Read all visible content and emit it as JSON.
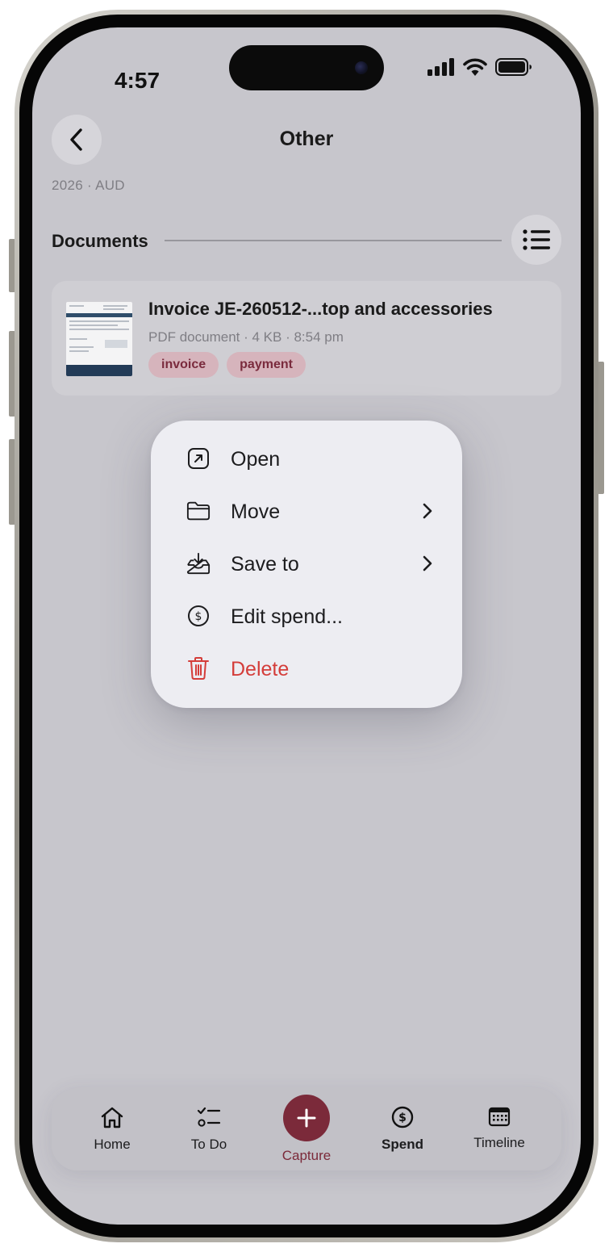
{
  "status_bar": {
    "time": "4:57"
  },
  "header": {
    "title": "Other",
    "subtitle": "2026 · AUD"
  },
  "section": {
    "title": "Documents"
  },
  "document": {
    "title": "Invoice JE-260512-...top and accessories",
    "meta": "PDF document · 4 KB · 8:54 pm",
    "tags": [
      "invoice",
      "payment"
    ]
  },
  "context_menu": {
    "items": [
      {
        "label": "Open",
        "icon": "open-external-icon"
      },
      {
        "label": "Move",
        "icon": "folder-icon",
        "submenu": true
      },
      {
        "label": "Save to",
        "icon": "tray-download-icon",
        "submenu": true
      },
      {
        "label": "Edit spend...",
        "icon": "dollar-circle-icon"
      },
      {
        "label": "Delete",
        "icon": "trash-icon",
        "destructive": true
      }
    ]
  },
  "tab_bar": {
    "home": "Home",
    "todo": "To Do",
    "capture": "Capture",
    "spend": "Spend",
    "timeline": "Timeline",
    "active": "Spend"
  },
  "colors": {
    "accent": "#7b2a3a",
    "destructive": "#d43d3a",
    "tag_bg": "#d6b4bc",
    "tag_text": "#7a2b3d"
  }
}
